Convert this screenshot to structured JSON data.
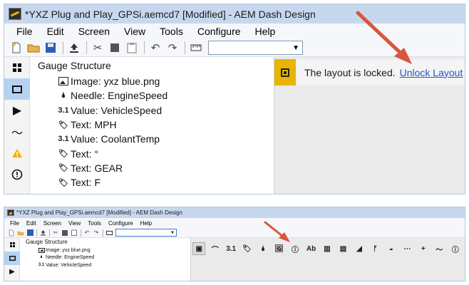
{
  "accent_colors": {
    "arrow": "#d9553b",
    "lock_badge": "#e8b400",
    "link": "#1f57c9",
    "selection": "#b6d2f2"
  },
  "top": {
    "title": "*YXZ Plug and Play_GPSi.aemcd7 [Modified] - AEM Dash Design",
    "menu": [
      "File",
      "Edit",
      "Screen",
      "View",
      "Tools",
      "Configure",
      "Help"
    ],
    "toolbar": {
      "new_icon": "new-file-icon",
      "open_icon": "open-folder-icon",
      "save_icon": "save-icon",
      "upload_icon": "upload-icon",
      "cut_icon": "cut-icon",
      "copy_icon": "copy-icon",
      "paste_icon": "paste-icon",
      "undo_icon": "undo-icon",
      "redo_icon": "redo-icon",
      "ruler_icon": "ruler-icon",
      "dropdown_value": ""
    },
    "sidebar": [
      "layout-icon",
      "select-icon",
      "play-icon",
      "chart-icon",
      "warning-icon",
      "alert-icon"
    ],
    "tree": {
      "header": "Gauge Structure",
      "items": [
        {
          "glyph": "",
          "type": "image",
          "label": "Image: yxz blue.png"
        },
        {
          "glyph": "🌢",
          "type": "needle",
          "label": "Needle: EngineSpeed"
        },
        {
          "glyph": "3.1",
          "type": "value",
          "label": "Value: VehicleSpeed"
        },
        {
          "glyph": "🏷",
          "type": "text",
          "label": "Text: MPH"
        },
        {
          "glyph": "3.1",
          "type": "value",
          "label": "Value: CoolantTemp"
        },
        {
          "glyph": "🏷",
          "type": "text",
          "label": "Text: °"
        },
        {
          "glyph": "🏷",
          "type": "text",
          "label": "Text: GEAR"
        },
        {
          "glyph": "🏷",
          "type": "text",
          "label": "Text: F"
        }
      ]
    },
    "lock_banner": {
      "message": "The layout is locked.",
      "link": "Unlock Layout"
    }
  },
  "bottom": {
    "title": "*YXZ Plug and Play_GPSi.aemcd7 [Modified] - AEM Dash Design",
    "menu": [
      "File",
      "Edit",
      "Screen",
      "View",
      "Tools",
      "Configure",
      "Help"
    ],
    "tree": {
      "header": "Gauge Structure",
      "items": [
        {
          "glyph": "",
          "type": "image",
          "label": "Image: yxz blue.png"
        },
        {
          "glyph": "🌢",
          "type": "needle",
          "label": "Needle: EngineSpeed"
        },
        {
          "glyph": "3.1",
          "type": "value",
          "label": "Value: VehicleSpeed"
        }
      ]
    },
    "palette": [
      {
        "name": "layout-icon",
        "glyph": "▣"
      },
      {
        "name": "gauge-arc-icon",
        "glyph": "⌒"
      },
      {
        "name": "value-icon",
        "glyph": "3.1"
      },
      {
        "name": "tag-icon",
        "glyph": "🏷"
      },
      {
        "name": "needle-icon",
        "glyph": "🌢"
      },
      {
        "name": "image-icon",
        "glyph": "🖼"
      },
      {
        "name": "alert-icon",
        "glyph": "ⓘ"
      },
      {
        "name": "text-icon",
        "glyph": "Ab"
      },
      {
        "name": "bar-icon",
        "glyph": "▥"
      },
      {
        "name": "vertical-bar-icon",
        "glyph": "▤"
      },
      {
        "name": "sweep-icon",
        "glyph": "◢"
      },
      {
        "name": "gear-shift-icon",
        "glyph": "ᚠ"
      },
      {
        "name": "lamp-icon",
        "glyph": "◒"
      },
      {
        "name": "dashes-icon",
        "glyph": "⋯"
      },
      {
        "name": "plus-icon",
        "glyph": "+"
      },
      {
        "name": "graph-icon",
        "glyph": "〜"
      },
      {
        "name": "info-icon",
        "glyph": "ⓘ"
      }
    ]
  }
}
